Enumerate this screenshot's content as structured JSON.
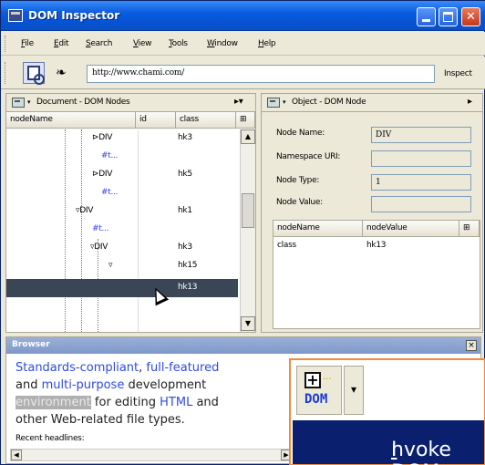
{
  "window": {
    "title": "DOM Inspector"
  },
  "menu": {
    "items": [
      {
        "label": "File",
        "u": "F",
        "rest": "ile"
      },
      {
        "label": "Edit",
        "u": "E",
        "rest": "dit"
      },
      {
        "label": "Search",
        "u": "S",
        "rest": "earch"
      },
      {
        "label": "View",
        "u": "V",
        "rest": "iew"
      },
      {
        "label": "Tools",
        "u": "T",
        "rest": "ools"
      },
      {
        "label": "Window",
        "u": "W",
        "rest": "indow"
      },
      {
        "label": "Help",
        "u": "H",
        "rest": "elp"
      }
    ]
  },
  "toolbar": {
    "url": "http://www.chami.com/",
    "inspect_label": "Inspect"
  },
  "left_panel": {
    "title": "Document - DOM Nodes",
    "columns": [
      "nodeName",
      "id",
      "class"
    ],
    "rows": [
      {
        "node": "DIV",
        "prefix": "⊳",
        "cls": "hk3",
        "blue": false
      },
      {
        "node": "#t...",
        "prefix": "",
        "cls": "",
        "blue": true
      },
      {
        "node": "DIV",
        "prefix": "⊳",
        "cls": "hk5",
        "blue": false
      },
      {
        "node": "#t...",
        "prefix": "",
        "cls": "",
        "blue": true
      },
      {
        "node": "DIV",
        "prefix": "▿",
        "cls": "hk1",
        "blue": false
      },
      {
        "node": "#t...",
        "prefix": "",
        "cls": "",
        "blue": true
      },
      {
        "node": "DIV",
        "prefix": "▿",
        "cls": "hk3",
        "blue": false
      },
      {
        "node": "",
        "prefix": "▿",
        "cls": "hk15",
        "blue": false
      },
      {
        "node": "",
        "prefix": "",
        "cls": "hk13",
        "blue": false
      }
    ]
  },
  "right_panel": {
    "title": "Object - DOM Node",
    "fields": [
      {
        "label": "Node Name:",
        "value": "DIV"
      },
      {
        "label": "Namespace URI:",
        "value": ""
      },
      {
        "label": "Node Type:",
        "value": "1"
      },
      {
        "label": "Node Value:",
        "value": ""
      }
    ],
    "attr_columns": [
      "nodeName",
      "nodeValue"
    ],
    "attr_rows": [
      {
        "name": "class",
        "value": "hk13"
      }
    ]
  },
  "browser": {
    "title": "Browser",
    "line1_a": "Standards-compliant",
    "line1_b": ", ",
    "line1_c": "full-featured",
    "line2_a": "and ",
    "line2_b": "multi-purpose",
    "line2_c": " development",
    "line3_a": "environment",
    "line3_b": " for editing ",
    "line3_c": "HTML",
    "line3_d": " and",
    "line4": "other Web-related file types.",
    "recent": "Recent headlines:"
  },
  "zoom": {
    "plus": "+",
    "ellipsis": "...",
    "dom_label": "DOM",
    "tooltip_u": "I",
    "tooltip_rest": "nvoke DOM"
  }
}
